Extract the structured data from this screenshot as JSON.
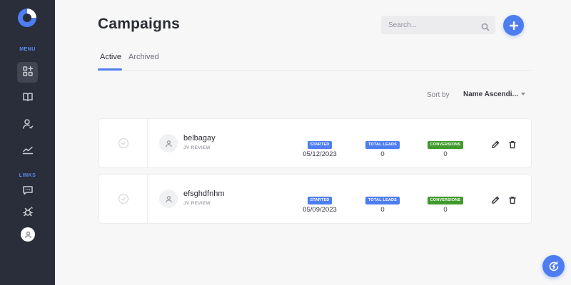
{
  "colors": {
    "accent": "#4d7df0",
    "sidebar_bg": "#2a2d3a",
    "badge_green": "#3f9a2b",
    "background": "#f7f7f8"
  },
  "sidebar": {
    "menu_label": "MENU",
    "links_label": "LINKS",
    "items": [
      {
        "icon": "dashboard-icon"
      },
      {
        "icon": "book-icon"
      },
      {
        "icon": "user-icon"
      },
      {
        "icon": "chart-line-icon"
      },
      {
        "icon": "chat-icon"
      },
      {
        "icon": "bug-icon"
      }
    ]
  },
  "header": {
    "title": "Campaigns",
    "search_placeholder": "Search..."
  },
  "tabs": [
    {
      "label": "Active",
      "active": true
    },
    {
      "label": "Archived",
      "active": false
    }
  ],
  "sort": {
    "label": "Sort by",
    "value": "Name Ascendi..."
  },
  "campaigns": [
    {
      "name": "belbagay",
      "subtitle": "JV REVIEW",
      "started_label": "STARTED",
      "started": "05/12/2023",
      "leads_label": "TOTAL LEADS",
      "leads": "0",
      "conversions_label": "CONVERSIONS",
      "conversions": "0"
    },
    {
      "name": "efsghdfnhm",
      "subtitle": "JV REVIEW",
      "started_label": "STARTED",
      "started": "05/09/2023",
      "leads_label": "TOTAL LEADS",
      "leads": "0",
      "conversions_label": "CONVERSIONS",
      "conversions": "0"
    }
  ]
}
